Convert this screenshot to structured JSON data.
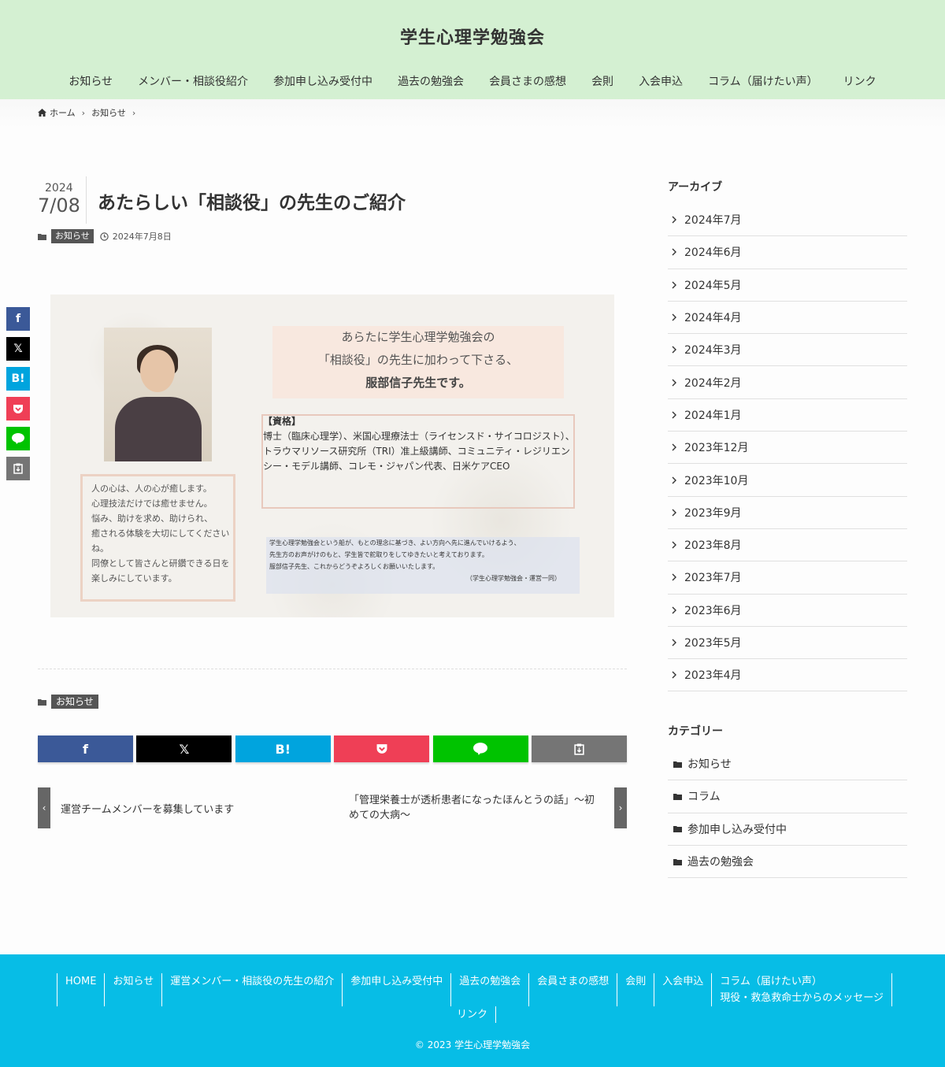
{
  "header": {
    "site_title": "学生心理学勉強会",
    "nav": [
      "お知らせ",
      "メンバー・相談役紹介",
      "参加申し込み受付中",
      "過去の勉強会",
      "会員さまの感想",
      "会則",
      "入会申込",
      "コラム（届けたい声）",
      "リンク"
    ]
  },
  "breadcrumb": {
    "home": "ホーム",
    "current": "お知らせ"
  },
  "post": {
    "year": "2024",
    "month_day": "7/08",
    "title": "あたらしい「相談役」の先生のご紹介",
    "category": "お知らせ",
    "date": "2024年7月8日"
  },
  "hero": {
    "line1": "あらたに学生心理学勉強会の",
    "line2": "「相談役」の先生に加わって下さる、",
    "line3": "服部信子先生です。",
    "qual_title": "【資格】",
    "qual_body": "博士（臨床心理学）、米国心理療法士（ライセンスド・サイコロジスト）、トラウマリソース研究所（TRI）准上級講師、コミュニティ・レジリエンシー・モデル講師、コレモ・ジャパン代表、日米ケアCEO",
    "quote": [
      "人の心は、人の心が癒します。",
      "心理技法だけでは癒せません。",
      "悩み、助けを求め、助けられ、",
      "癒される体験を大切にしてください",
      "ね。",
      "同僚として皆さんと研鑽できる日を",
      "楽しみにしています。"
    ],
    "message": [
      "学生心理学勉強会という船が、もとの理念に基づき、よい方向へ先に進んでいけるよう、",
      "先生方のお声がけのもと、学生皆で舵取りをしてゆきたいと考えております。",
      "服部信子先生、これからどうぞよろしくお願いいたします。"
    ],
    "message_sign": "（学生心理学勉強会・運営一同）"
  },
  "share": {
    "facebook": "f",
    "x": "𝕏",
    "hatena": "B!",
    "pocket": "pocket-icon",
    "line": "LINE",
    "copy": "copy-icon"
  },
  "prev_next": {
    "prev": "運営チームメンバーを募集しています",
    "next": "「管理栄養士が透析患者になったほんとうの話」〜初めての大病〜"
  },
  "sidebar": {
    "archive_title": "アーカイブ",
    "archives": [
      "2024年7月",
      "2024年6月",
      "2024年5月",
      "2024年4月",
      "2024年3月",
      "2024年2月",
      "2024年1月",
      "2023年12月",
      "2023年10月",
      "2023年9月",
      "2023年8月",
      "2023年7月",
      "2023年6月",
      "2023年5月",
      "2023年4月"
    ],
    "category_title": "カテゴリー",
    "categories": [
      "お知らせ",
      "コラム",
      "参加申し込み受付中",
      "過去の勉強会"
    ]
  },
  "footer": {
    "nav": [
      "HOME",
      "お知らせ",
      "運営メンバー・相談役の先生の紹介",
      "参加申し込み受付中",
      "過去の勉強会",
      "会員さまの感想",
      "会則",
      "入会申込",
      "コラム（届けたい声）",
      "現役・救急救命士からのメッセージ"
    ],
    "nav2": [
      "リンク"
    ],
    "copyright": "© 2023 学生心理学勉強会"
  },
  "colors": {
    "header_bg": "#d4f0d2",
    "footer_bg": "#07bde6",
    "badge_bg": "#555555"
  }
}
